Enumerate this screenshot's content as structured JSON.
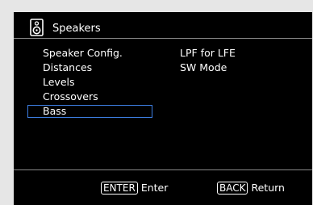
{
  "header": {
    "icon": "speaker-icon",
    "title": "Speakers"
  },
  "menu": {
    "left": [
      {
        "label": "Speaker Config."
      },
      {
        "label": "Distances"
      },
      {
        "label": "Levels"
      },
      {
        "label": "Crossovers"
      },
      {
        "label": "Bass",
        "selected": true
      }
    ],
    "right": [
      {
        "label": "LPF for LFE"
      },
      {
        "label": "SW Mode"
      }
    ]
  },
  "footer": {
    "enter_key": "ENTER",
    "enter_label": "Enter",
    "back_key": "BACK",
    "back_label": "Return"
  },
  "colors": {
    "background": "#000000",
    "outer_background": "#e6e6e6",
    "text": "#ffffff",
    "selection_border": "#3c7de0",
    "divider": "#8a8a8a"
  }
}
